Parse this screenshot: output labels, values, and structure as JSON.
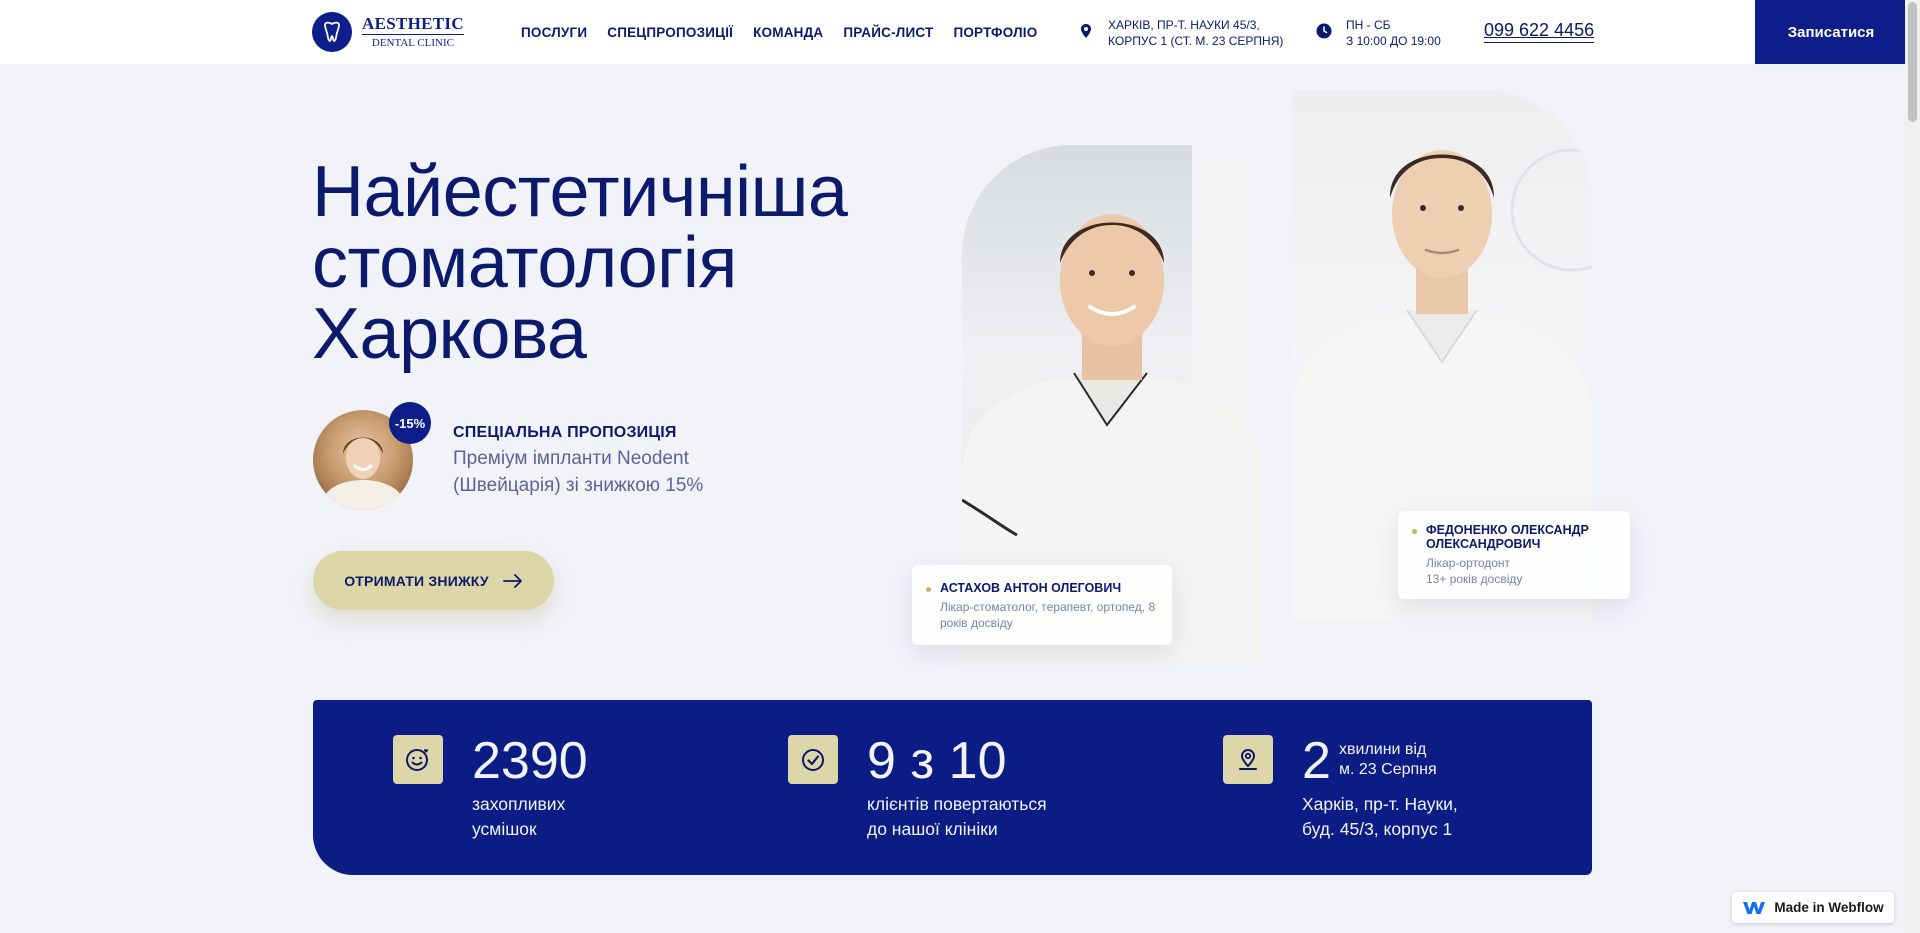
{
  "header": {
    "logo": {
      "line1": "AESTHETIC",
      "line2": "DENTAL CLINIC"
    },
    "nav": [
      "ПОСЛУГИ",
      "СПЕЦПРОПОЗИЦІЇ",
      "КОМАНДА",
      "ПРАЙС-ЛИСТ",
      "ПОРТФОЛІО"
    ],
    "address": {
      "line1": "ХАРКІВ, ПР-Т. НАУКИ 45/3,",
      "line2": "КОРПУС 1 (СТ. М. 23 СЕРПНЯ)",
      "icon": "location-pin-icon"
    },
    "hours": {
      "line1": "ПН - СБ",
      "line2": "З 10:00 ДО 19:00",
      "icon": "clock-icon"
    },
    "phone": "099 622 4456",
    "book_label": "Записатися"
  },
  "hero": {
    "title": "Найестетичніша стоматологія Харкова",
    "promo": {
      "badge": "-15%",
      "label": "СПЕЦІАЛЬНА ПРОПОЗИЦІЯ",
      "description": "Преміум імпланти Neodent (Швейцарія) зі знижкою 15%"
    },
    "cta_label": "ОТРИМАТИ ЗНИЖКУ"
  },
  "doctors": [
    {
      "name": "АСТАХОВ АНТОН ОЛЕГОВИЧ",
      "role": "Лікар-стоматолог, терапевт, ортопед, 8 років досвіду"
    },
    {
      "name": "ФЕДОНЕНКО ОЛЕКСАНДР ОЛЕКСАНДРОВИЧ",
      "role_line1": "Лікар-ортодонт",
      "role_line2": "13+ років досвіду"
    }
  ],
  "stats": [
    {
      "value": "2390",
      "desc_line1": "захопливих",
      "desc_line2": "усмішок",
      "icon": "smile-heart-icon"
    },
    {
      "value": "9 з 10",
      "desc_line1": "клієнтів повертаються",
      "desc_line2": "до нашої клініки",
      "icon": "check-circle-icon"
    },
    {
      "value": "2",
      "small_line1": "хвилини від",
      "small_line2": "м. 23 Серпня",
      "desc_line1": "Харків, пр-т. Науки,",
      "desc_line2": "буд. 45/3, корпус 1",
      "icon": "map-pin-icon"
    }
  ],
  "badge": {
    "label": "Made in Webflow",
    "icon": "webflow-logo-icon"
  },
  "colors": {
    "primary": "#0d1d8a",
    "accent": "#ddd6a8",
    "background": "#f2f3f9"
  }
}
